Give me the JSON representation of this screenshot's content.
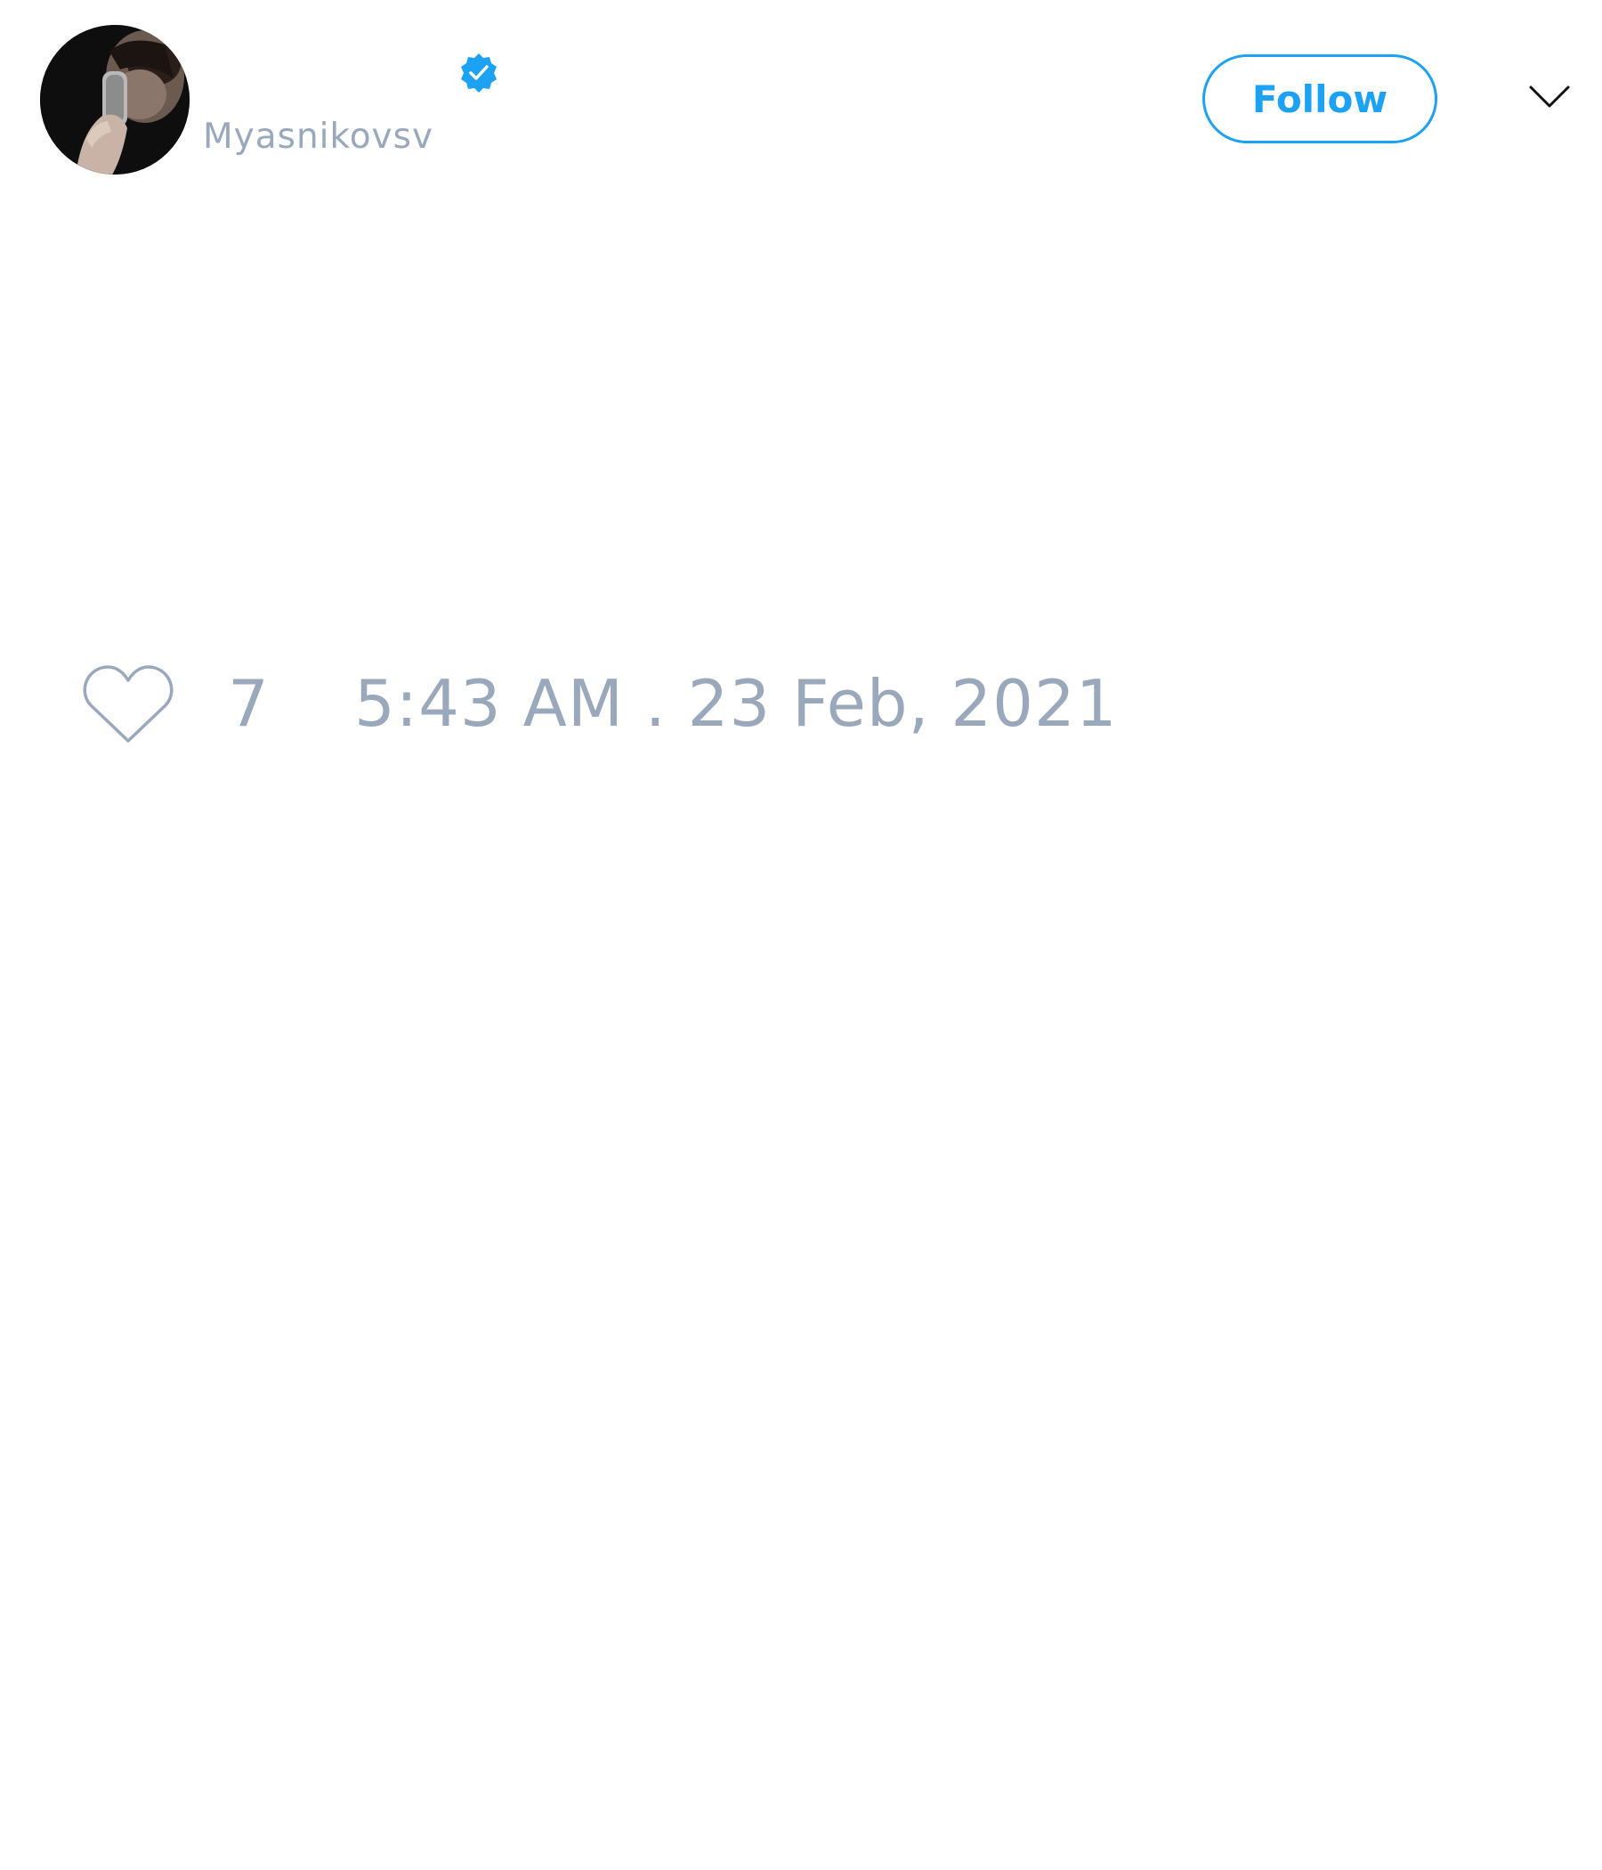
{
  "tweet": {
    "author": {
      "handle": "Myasnikovsv",
      "verified": true,
      "avatar_icon": "avatar-person-with-microphone"
    },
    "follow_button_label": "Follow",
    "menu_icon": "chevron-down-icon",
    "likes": {
      "icon": "heart-outline-icon",
      "count": "7"
    },
    "timestamp": "5:43 AM . 23 Feb, 2021"
  },
  "colors": {
    "accent": "#1da1f2",
    "muted_text": "#9aa8bc",
    "background": "#ffffff"
  }
}
